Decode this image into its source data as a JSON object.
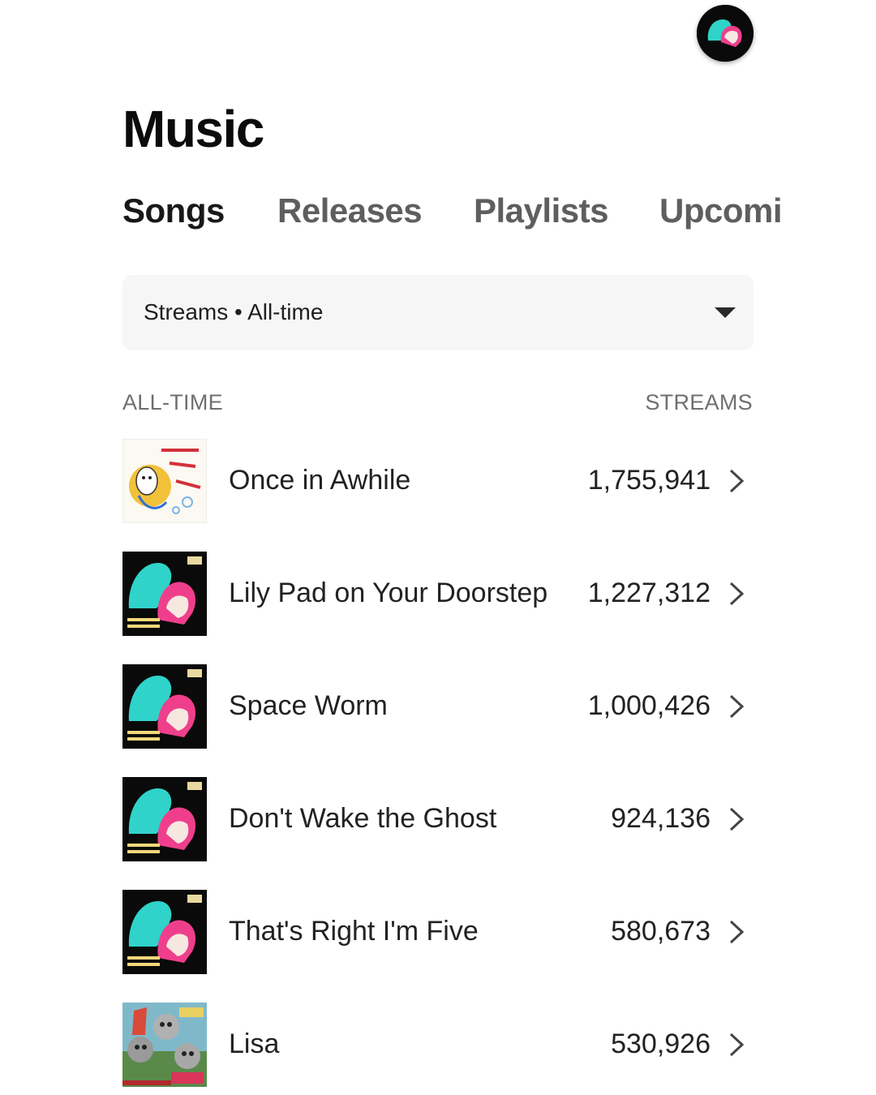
{
  "header": {
    "avatar_icon": "artist-avatar-icon"
  },
  "page_title": "Music",
  "tabs": [
    {
      "label": "Songs",
      "active": true
    },
    {
      "label": "Releases",
      "active": false
    },
    {
      "label": "Playlists",
      "active": false
    },
    {
      "label": "Upcoming",
      "active": false
    }
  ],
  "filter": {
    "label": "Streams • All-time",
    "icon": "caret-down-icon"
  },
  "table": {
    "left_header": "ALL-TIME",
    "right_header": "STREAMS",
    "rows": [
      {
        "title": "Once in Awhile",
        "streams": "1,755,941",
        "art": "dont-stop-or-well-die-cover"
      },
      {
        "title": "Lily Pad on Your Doorstep",
        "streams": "1,227,312",
        "art": "dazzle-me-cover"
      },
      {
        "title": "Space Worm",
        "streams": "1,000,426",
        "art": "dazzle-me-cover"
      },
      {
        "title": "Don't Wake the Ghost",
        "streams": "924,136",
        "art": "dazzle-me-cover"
      },
      {
        "title": "That's Right I'm Five",
        "streams": "580,673",
        "art": "dazzle-me-cover"
      },
      {
        "title": "Lisa",
        "streams": "530,926",
        "art": "gorgeous-cover"
      }
    ]
  },
  "colors": {
    "text": "#1a1a1a",
    "muted": "#6f6f6f",
    "filter_bg": "#f6f6f6"
  }
}
